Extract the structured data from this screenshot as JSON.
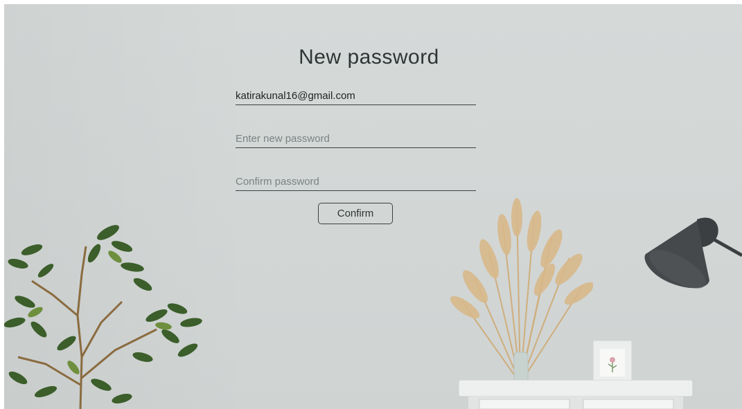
{
  "form": {
    "title": "New password",
    "email_value": "katirakunal16@gmail.com",
    "new_password_placeholder": "Enter new password",
    "confirm_password_placeholder": "Confirm password",
    "confirm_button_label": "Confirm"
  },
  "colors": {
    "wall": "#d3d7d6",
    "text": "#2f3435",
    "underline": "#3a3f40",
    "plant_leaf": "#3b5e2a",
    "pampas": "#cfae7c",
    "lamp": "#3c3f41",
    "cabinet": "#eef0f0"
  },
  "decor": {
    "plant": "plant-image",
    "vase": "dried-grass-vase-image",
    "lamp": "lamp-image",
    "frame": "picture-frame-image",
    "cabinet": "side-cabinet-image"
  }
}
